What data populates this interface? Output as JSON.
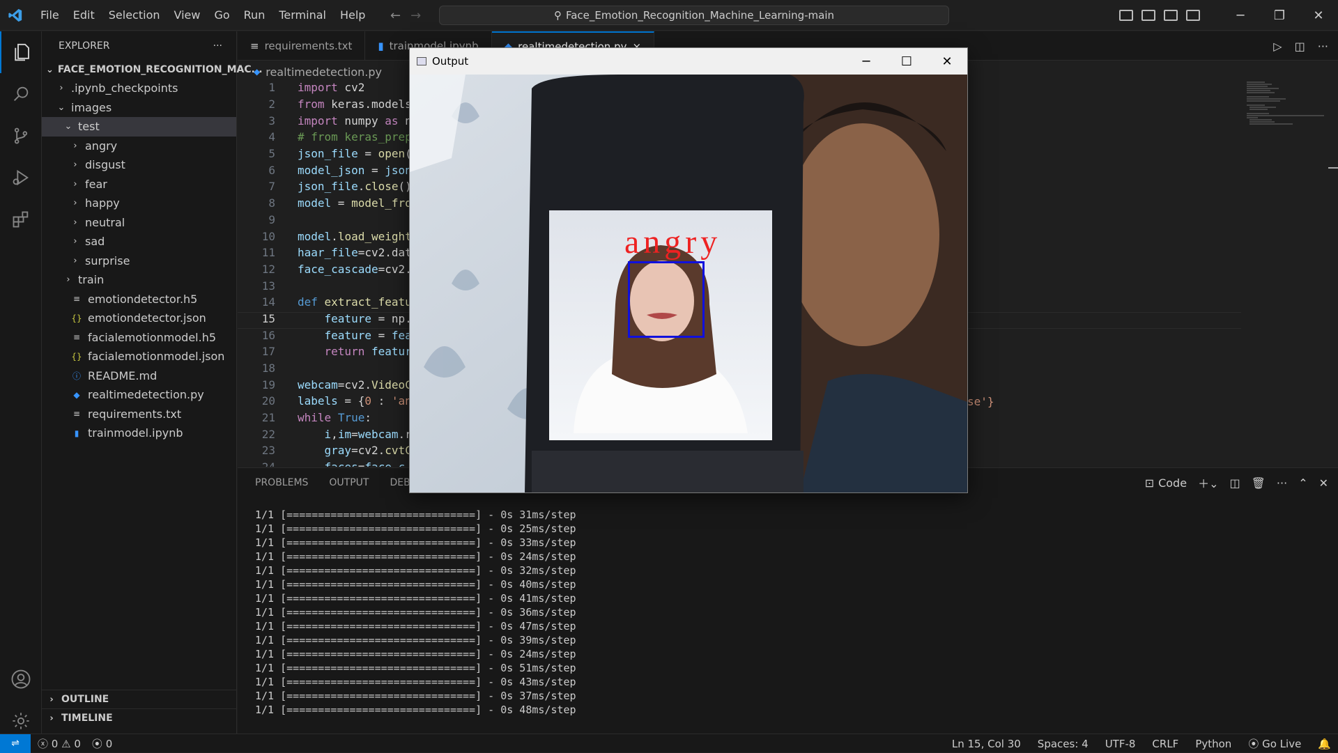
{
  "menu": [
    "File",
    "Edit",
    "Selection",
    "View",
    "Go",
    "Run",
    "Terminal",
    "Help"
  ],
  "search": {
    "text": "Face_Emotion_Recognition_Machine_Learning-main"
  },
  "explorer": {
    "title": "EXPLORER",
    "more": "···",
    "root": "FACE_EMOTION_RECOGNITION_MAC...",
    "items": [
      {
        "label": ".ipynb_checkpoints",
        "indent": 1,
        "chev": "›",
        "icon": ""
      },
      {
        "label": "images",
        "indent": 1,
        "chev": "⌄",
        "icon": ""
      },
      {
        "label": "test",
        "indent": 2,
        "chev": "⌄",
        "icon": "",
        "selected": true
      },
      {
        "label": "angry",
        "indent": 3,
        "chev": "›",
        "icon": ""
      },
      {
        "label": "disgust",
        "indent": 3,
        "chev": "›",
        "icon": ""
      },
      {
        "label": "fear",
        "indent": 3,
        "chev": "›",
        "icon": ""
      },
      {
        "label": "happy",
        "indent": 3,
        "chev": "›",
        "icon": ""
      },
      {
        "label": "neutral",
        "indent": 3,
        "chev": "›",
        "icon": ""
      },
      {
        "label": "sad",
        "indent": 3,
        "chev": "›",
        "icon": ""
      },
      {
        "label": "surprise",
        "indent": 3,
        "chev": "›",
        "icon": ""
      },
      {
        "label": "train",
        "indent": 2,
        "chev": "›",
        "icon": ""
      },
      {
        "label": "emotiondetector.h5",
        "indent": 1,
        "chev": "",
        "icon": "≡",
        "iconColor": "#cccccc"
      },
      {
        "label": "emotiondetector.json",
        "indent": 1,
        "chev": "",
        "icon": "{}",
        "iconColor": "#cbcb41"
      },
      {
        "label": "facialemotionmodel.h5",
        "indent": 1,
        "chev": "",
        "icon": "≡",
        "iconColor": "#cccccc"
      },
      {
        "label": "facialemotionmodel.json",
        "indent": 1,
        "chev": "",
        "icon": "{}",
        "iconColor": "#cbcb41"
      },
      {
        "label": "README.md",
        "indent": 1,
        "chev": "",
        "icon": "ⓘ",
        "iconColor": "#3794ff"
      },
      {
        "label": "realtimedetection.py",
        "indent": 1,
        "chev": "",
        "icon": "◆",
        "iconColor": "#3794ff"
      },
      {
        "label": "requirements.txt",
        "indent": 1,
        "chev": "",
        "icon": "≡",
        "iconColor": "#cccccc"
      },
      {
        "label": "trainmodel.ipynb",
        "indent": 1,
        "chev": "",
        "icon": "▮",
        "iconColor": "#3794ff"
      }
    ],
    "outline": "OUTLINE",
    "timeline": "TIMELINE"
  },
  "tabs": [
    {
      "label": "requirements.txt",
      "icon": "≡",
      "active": false
    },
    {
      "label": "trainmodel.ipynb",
      "icon": "▮",
      "active": false
    },
    {
      "label": "realtimedetection.py",
      "icon": "◆",
      "active": true,
      "close": "×"
    }
  ],
  "breadcrumb": "realtimedetection.py",
  "code_lines": [
    {
      "n": "1",
      "html": "<span class='kw'>import</span> cv2"
    },
    {
      "n": "2",
      "html": "<span class='kw'>from</span> keras.models"
    },
    {
      "n": "3",
      "html": "<span class='kw'>import</span> numpy <span class='kw'>as</span> n"
    },
    {
      "n": "4",
      "html": "<span class='cm'># from keras_prep</span>"
    },
    {
      "n": "5",
      "html": "<span class='var'>json_file</span> = <span class='fn'>open</span>("
    },
    {
      "n": "6",
      "html": "<span class='var'>model_json</span> = <span class='var'>json</span>"
    },
    {
      "n": "7",
      "html": "<span class='var'>json_file</span>.<span class='fn'>close</span>()"
    },
    {
      "n": "8",
      "html": "<span class='var'>model</span> = <span class='fn'>model_fro</span>"
    },
    {
      "n": "9",
      "html": ""
    },
    {
      "n": "10",
      "html": "<span class='var'>model</span>.<span class='fn'>load_weight</span>"
    },
    {
      "n": "11",
      "html": "<span class='var'>haar_file</span>=cv2.dat"
    },
    {
      "n": "12",
      "html": "<span class='var'>face_cascade</span>=cv2."
    },
    {
      "n": "13",
      "html": ""
    },
    {
      "n": "14",
      "html": "<span class='kwb'>def</span> <span class='fn'>extract_featu</span>"
    },
    {
      "n": "15",
      "html": "    <span class='var'>feature</span> = np.",
      "cur": true
    },
    {
      "n": "16",
      "html": "    <span class='var'>feature</span> = <span class='var'>fea</span>"
    },
    {
      "n": "17",
      "html": "    <span class='kw'>return</span> <span class='var'>featur</span>"
    },
    {
      "n": "18",
      "html": ""
    },
    {
      "n": "19",
      "html": "<span class='var'>webcam</span>=cv2.<span class='fn'>VideoC</span>"
    },
    {
      "n": "20",
      "html": "<span class='var'>labels</span> = {<span class='str'>0</span> : <span class='str'>'an</span>"
    },
    {
      "n": "21",
      "html": "<span class='kw'>while</span> <span class='kwb'>True</span>:"
    },
    {
      "n": "22",
      "html": "    <span class='var'>i</span>,<span class='var'>im</span>=<span class='var'>webcam</span>.r"
    },
    {
      "n": "23",
      "html": "    <span class='var'>gray</span>=cv2.<span class='fn'>cvtC</span>"
    },
    {
      "n": "24",
      "html": "    <span class='var'>faces</span>=<span class='var'>face_c</span>"
    }
  ],
  "labels_tail": "se'}",
  "panel": {
    "tabs": [
      "PROBLEMS",
      "OUTPUT",
      "DEBUG"
    ],
    "terminal_label": "Code",
    "lines": [
      "1/1 [==============================] - 0s 31ms/step",
      "1/1 [==============================] - 0s 25ms/step",
      "1/1 [==============================] - 0s 33ms/step",
      "1/1 [==============================] - 0s 24ms/step",
      "1/1 [==============================] - 0s 32ms/step",
      "1/1 [==============================] - 0s 40ms/step",
      "1/1 [==============================] - 0s 41ms/step",
      "1/1 [==============================] - 0s 36ms/step",
      "1/1 [==============================] - 0s 47ms/step",
      "1/1 [==============================] - 0s 39ms/step",
      "1/1 [==============================] - 0s 24ms/step",
      "1/1 [==============================] - 0s 51ms/step",
      "1/1 [==============================] - 0s 43ms/step",
      "1/1 [==============================] - 0s 37ms/step",
      "1/1 [==============================] - 0s 48ms/step"
    ]
  },
  "output_window": {
    "title": "Output",
    "emotion": "angry",
    "box_color": "#1010dd",
    "label_color": "#ee2222"
  },
  "status": {
    "errors": "0",
    "warnings": "0",
    "ports": "0",
    "position": "Ln 15, Col 30",
    "spaces": "Spaces: 4",
    "encoding": "UTF-8",
    "eol": "CRLF",
    "language": "Python",
    "golive": "Go Live"
  },
  "colors": {
    "accent": "#0078d4",
    "background": "#1f1f1f",
    "sidebar": "#181818"
  }
}
